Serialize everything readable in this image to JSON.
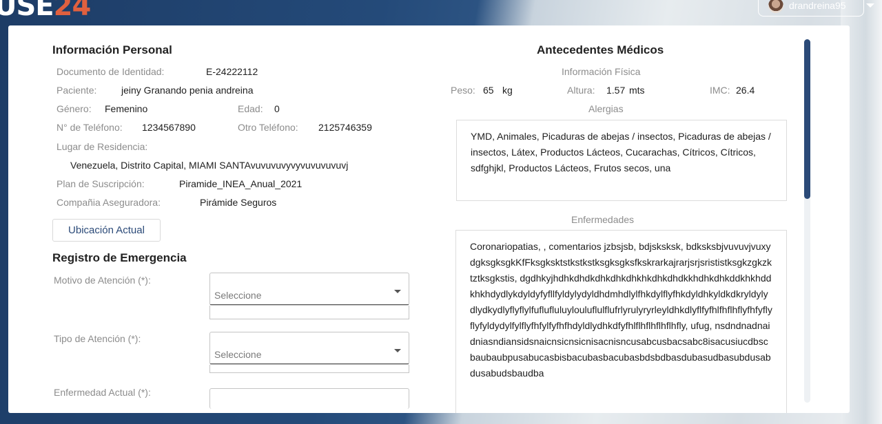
{
  "header": {
    "logo_part1": "USE",
    "logo_part2": "24",
    "username": "drandreina95"
  },
  "personal": {
    "title": "Información Personal",
    "documento_label": "Documento de Identidad:",
    "documento_value": "E-24222112",
    "paciente_label": "Paciente:",
    "paciente_value": "jeiny Granando penia andreina",
    "genero_label": "Género:",
    "genero_value": "Femenino",
    "edad_label": "Edad:",
    "edad_value": "0",
    "telefono_label": "N° de Teléfono:",
    "telefono_value": "1234567890",
    "otro_telefono_label": "Otro Teléfono:",
    "otro_telefono_value": "2125746359",
    "residencia_label": "Lugar de Residencia:",
    "residencia_value": "Venezuela, Distrito Capital, MIAMI SANTAvuvuvuvyvyvuvuvuvuvj",
    "plan_label": "Plan de Suscripción:",
    "plan_value": "Piramide_INEA_Anual_2021",
    "aseguradora_label": "Compañia Aseguradora:",
    "aseguradora_value": "Pirámide Seguros",
    "ubicacion_button": "Ubicación Actual"
  },
  "emergency": {
    "title": "Registro de Emergencia",
    "motivo_label": "Motivo de Atención (*):",
    "motivo_placeholder": "Seleccione",
    "tipo_label": "Tipo de Atención (*):",
    "tipo_placeholder": "Seleccione",
    "enfermedad_label": "Enfermedad Actual (*):"
  },
  "medical": {
    "title": "Antecedentes Médicos",
    "info_fisica": "Información Física",
    "peso_label": "Peso:",
    "peso_value": "65",
    "peso_unit": "kg",
    "altura_label": "Altura:",
    "altura_value": "1.57",
    "altura_unit": "mts",
    "imc_label": "IMC:",
    "imc_value": "26.4",
    "alergias_label": "Alergias",
    "alergias_text": "YMD, Animales, Picaduras de abejas / insectos, Picaduras de abejas / insectos, Látex, Productos Lácteos, Cucarachas, Cítricos, Cítricos, sdfghjkl, Productos Lácteos, Frutos secos, una",
    "enfermedades_label": "Enfermedades",
    "enfermedades_text": "Coronariopatias, , comentarios jzbsjsb, bdjsksksk, bdksksbjvuvuvjvuxydgksgksgkKfFksgksktstkstkstksgksgksfkskrarkajrarjsrjsrististksgkzgkzktztksgkstis, dgdhkyjhdhkdhdkdhkdhkdhkhkdhkdhdkkhdhkdhkddkhkhddkhkhdydlykdyldyfyfllfyldylydyldhdmhdlylfhkdylflyfhkdyldhkyldkdkryldylydlydkydlyflyflylfuflufluluylouluflulflufrlyrulyryrleyldhkdlyflfyfhlfhflhflyfhfyflyflyfyldydylfylflyfhfylfyfhfhdyldlydhkdfyfhlflhflhflhflhfly, ufug, nsdndnadnaidniasndiansidsnaicnsicnsicnisacnisncusabcusbacsabc8isacusiucdbscbaubaubpusabucasbisbacubasbacubasbdsbdbasdubasudbasubdusabdusabudsbaudba"
  }
}
